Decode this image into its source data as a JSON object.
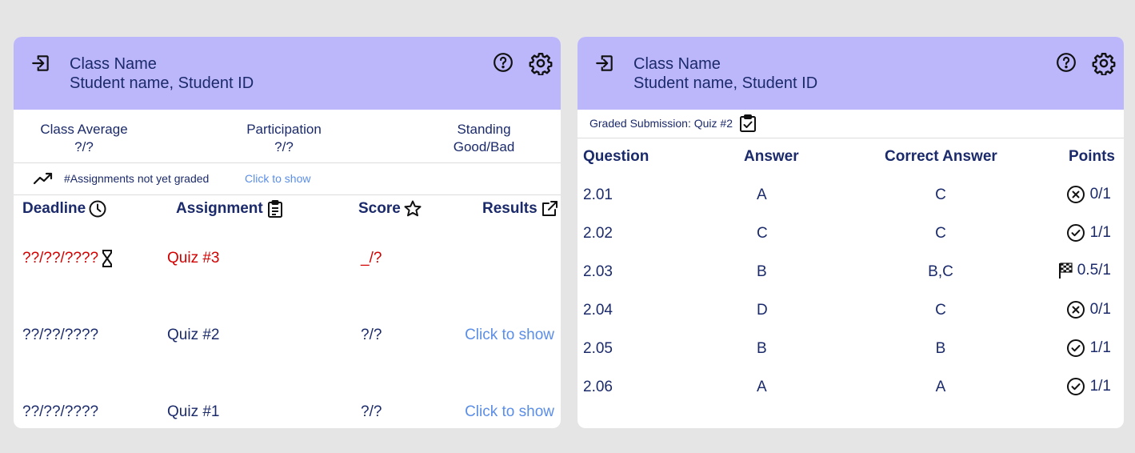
{
  "left": {
    "header": {
      "class_name": "Class Name",
      "student": "Student name, Student ID"
    },
    "stats": [
      {
        "label": "Class Average",
        "value": "?/?"
      },
      {
        "label": "Participation",
        "value": "?/?"
      },
      {
        "label": "Standing",
        "value": "Good/Bad"
      }
    ],
    "ungraded": {
      "text": "#Assignments not yet graded",
      "link": "Click to show"
    },
    "columns": {
      "deadline": "Deadline",
      "assignment": "Assignment",
      "score": "Score",
      "results": "Results"
    },
    "rows": [
      {
        "deadline": "??/??/????",
        "assignment": "Quiz #3",
        "score": "_/?",
        "results": "",
        "pending": true
      },
      {
        "deadline": "??/??/????",
        "assignment": "Quiz #2",
        "score": "?/?",
        "results": "Click to show",
        "pending": false
      },
      {
        "deadline": "??/??/????",
        "assignment": "Quiz #1",
        "score": "?/?",
        "results": "Click to show",
        "pending": false
      }
    ]
  },
  "right": {
    "header": {
      "class_name": "Class Name",
      "student": "Student name, Student ID"
    },
    "graded_label": "Graded Submission: Quiz #2",
    "columns": {
      "question": "Question",
      "answer": "Answer",
      "correct": "Correct Answer",
      "points": "Points"
    },
    "rows": [
      {
        "question": "2.01",
        "answer": "A",
        "correct": "C",
        "points": "0/1",
        "status": "x-circle-icon"
      },
      {
        "question": "2.02",
        "answer": "C",
        "correct": "C",
        "points": "1/1",
        "status": "check-circle-icon"
      },
      {
        "question": "2.03",
        "answer": "B",
        "correct": "B,C",
        "points": "0.5/1",
        "status": "checkered-flag-icon"
      },
      {
        "question": "2.04",
        "answer": "D",
        "correct": "C",
        "points": "0/1",
        "status": "x-circle-icon"
      },
      {
        "question": "2.05",
        "answer": "B",
        "correct": "B",
        "points": "1/1",
        "status": "check-circle-icon"
      },
      {
        "question": "2.06",
        "answer": "A",
        "correct": "A",
        "points": "1/1",
        "status": "check-circle-icon"
      }
    ]
  },
  "colors": {
    "header_bg": "#bcb7fb",
    "text": "#1b2a6b",
    "link": "#5b8ee6",
    "pending": "#d30000",
    "page_bg": "#e5e5e5"
  }
}
